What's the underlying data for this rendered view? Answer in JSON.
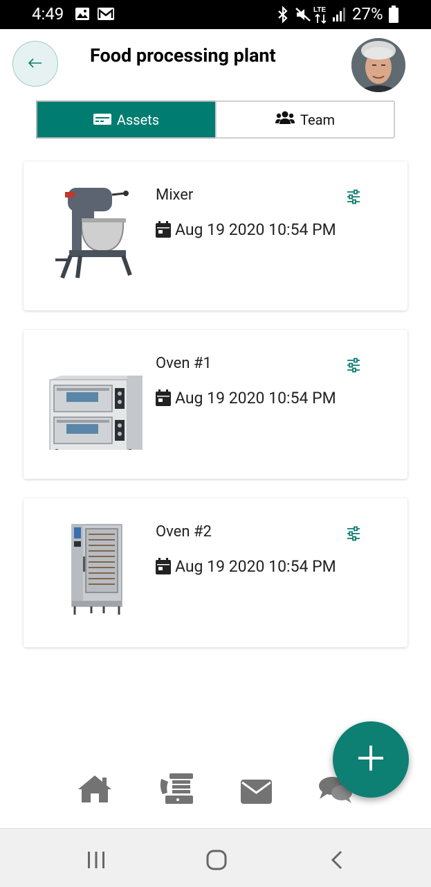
{
  "status_bar": {
    "time": "4:49",
    "battery": "27%",
    "icons": [
      "gallery-icon",
      "gmail-icon",
      "bluetooth-icon",
      "mute-icon",
      "lte-icon",
      "signal-icon",
      "battery-icon"
    ]
  },
  "header": {
    "title": "Food processing plant",
    "back_icon": "arrow-left-icon"
  },
  "tabs": [
    {
      "label": "Assets",
      "icon": "card-icon",
      "active": true
    },
    {
      "label": "Team",
      "icon": "users-icon",
      "active": false
    }
  ],
  "assets": [
    {
      "name": "Mixer",
      "date": "Aug 19 2020 10:54 PM",
      "image": "mixer"
    },
    {
      "name": "Oven #1",
      "date": "Aug 19 2020 10:54 PM",
      "image": "deck-oven"
    },
    {
      "name": "Oven #2",
      "date": "Aug 19 2020 10:54 PM",
      "image": "combi-oven"
    }
  ],
  "fab": {
    "icon": "plus-icon"
  },
  "bottom_nav": [
    {
      "icon": "home-icon"
    },
    {
      "icon": "helpdesk-icon"
    },
    {
      "icon": "mail-icon"
    },
    {
      "icon": "chat-icon"
    }
  ],
  "colors": {
    "accent": "#007c70",
    "fab": "#0e7f73",
    "nav_icon": "#737373",
    "back_bg": "#e6f2f1"
  }
}
